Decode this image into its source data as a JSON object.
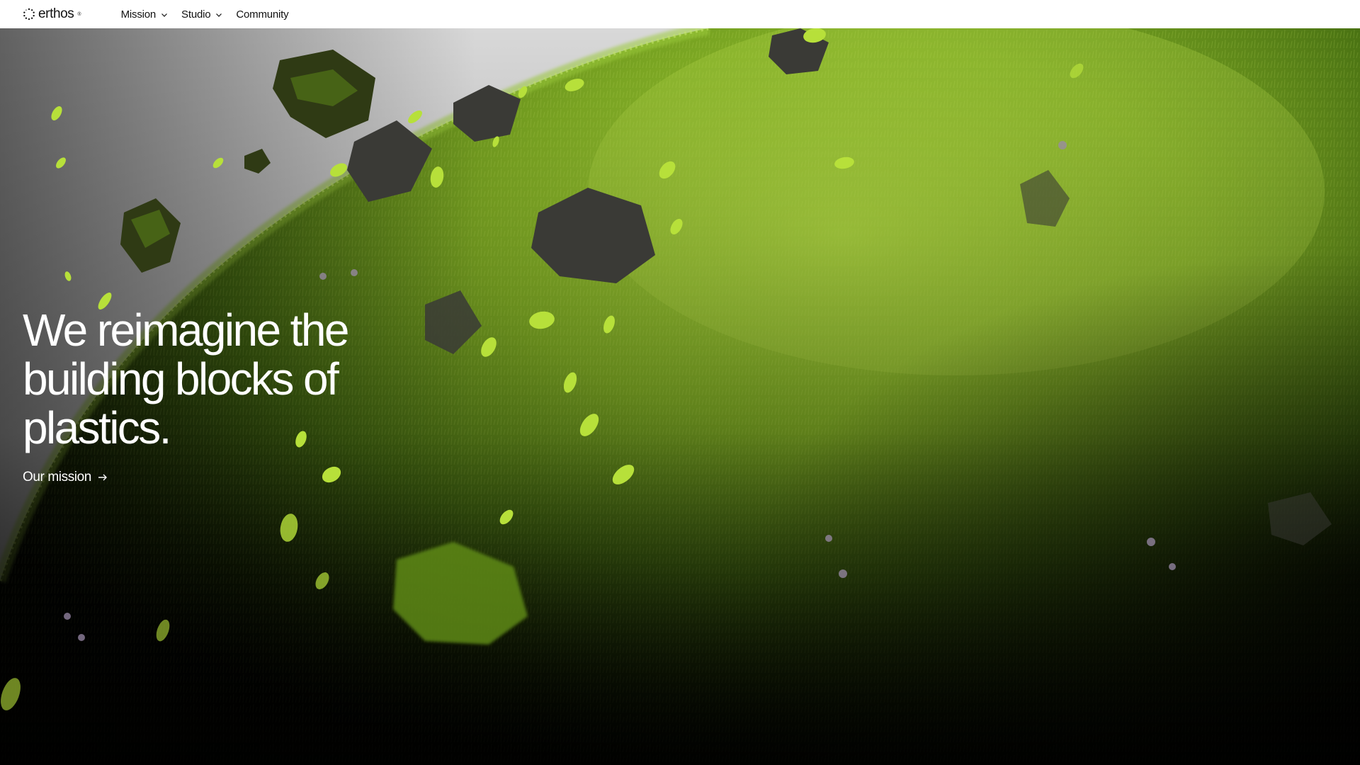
{
  "brand": {
    "name": "erthos",
    "mark": "®",
    "icon": "dotted-circle-logo-icon"
  },
  "nav": {
    "items": [
      {
        "label": "Mission",
        "has_dropdown": true,
        "icon": "chevron-down-icon"
      },
      {
        "label": "Studio",
        "has_dropdown": true,
        "icon": "chevron-down-icon"
      },
      {
        "label": "Community",
        "has_dropdown": false
      }
    ]
  },
  "hero": {
    "headline": "We reimagine the building blocks of plastics.",
    "cta_label": "Our mission",
    "cta_icon": "arrow-right-icon",
    "image_subject": "grass-covered sphere with floating rocks and leaves"
  },
  "colors": {
    "nav_background": "#ffffff",
    "nav_text": "#111111",
    "hero_text": "#ffffff",
    "sky": "#d9d9d9",
    "grass_light": "#a9d43a",
    "grass_mid": "#6f9a1e",
    "grass_dark": "#2f4a0c",
    "shadow": "#050703"
  }
}
